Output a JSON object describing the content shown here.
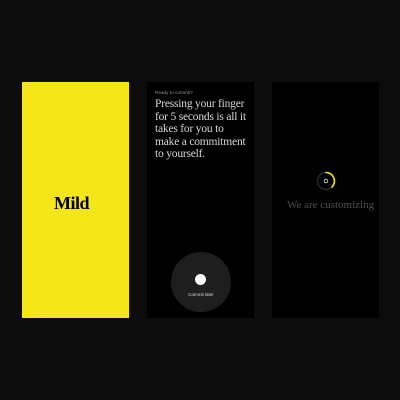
{
  "splash": {
    "logo_text": "Mild",
    "brand_color": "#f5e61a"
  },
  "commit_screen": {
    "kicker": "Ready to commit?",
    "headline": "Pressing your finger for 5  seconds is all it takes for you to make a commitment to yourself.",
    "commit_later_label": "Commit later"
  },
  "loading_screen": {
    "status_text": "We are customizing",
    "ring_accent": "#f5e61a"
  },
  "icons": [
    "press-dot-icon",
    "loading-ring-icon"
  ]
}
